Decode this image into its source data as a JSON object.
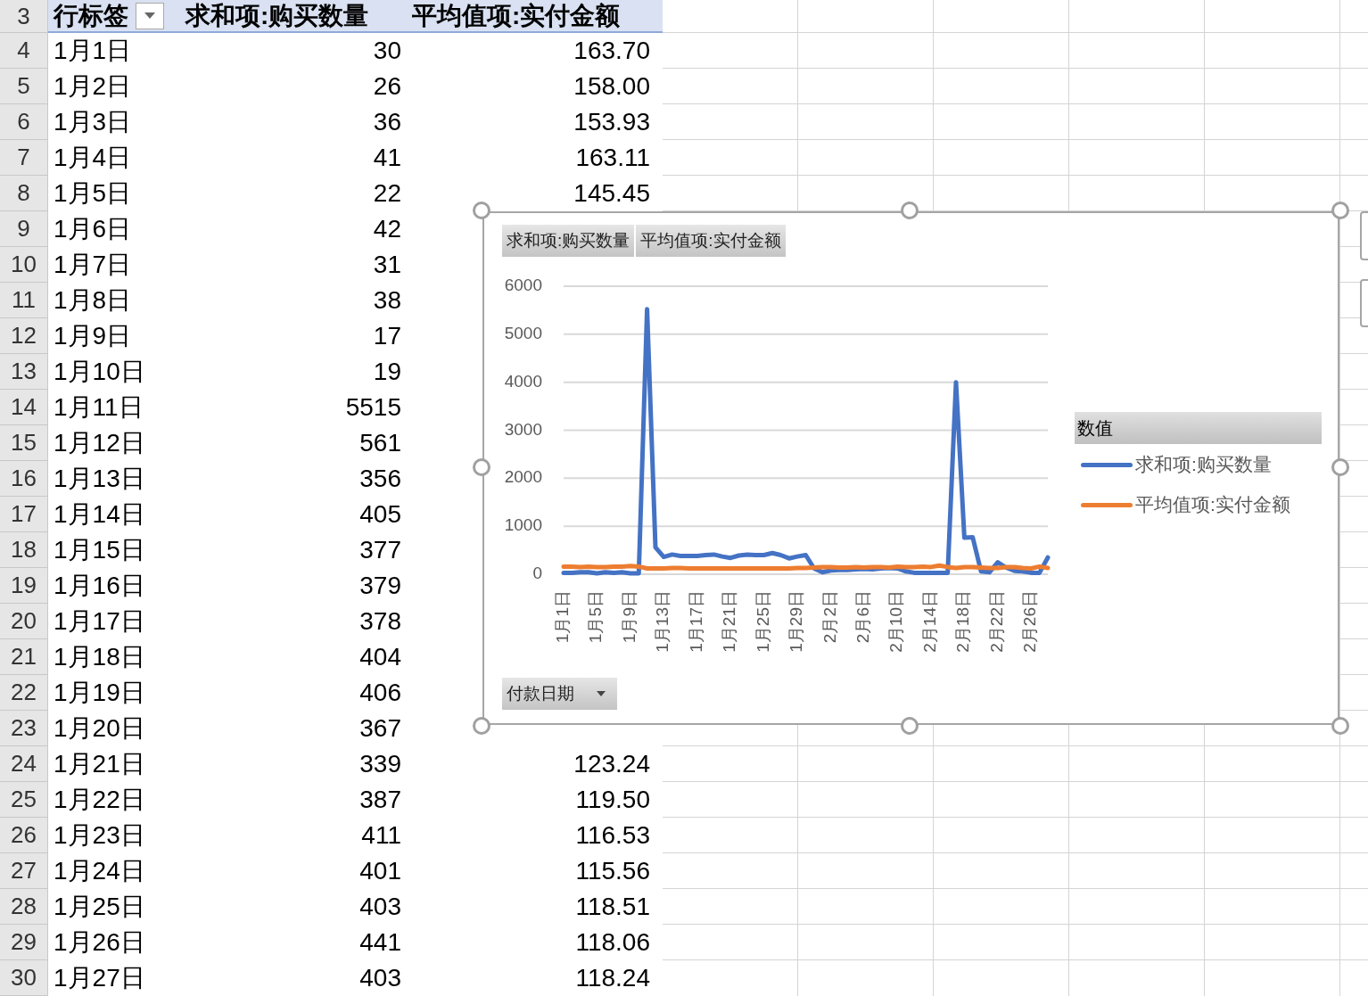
{
  "header": {
    "row_number": "3",
    "row_label": "行标签",
    "col_c": "求和项:购买数量",
    "col_d": "平均值项:实付金额"
  },
  "rows": [
    {
      "number": "4",
      "label": "1月1日",
      "quantity": "30",
      "amount": "163.70"
    },
    {
      "number": "5",
      "label": "1月2日",
      "quantity": "26",
      "amount": "158.00"
    },
    {
      "number": "6",
      "label": "1月3日",
      "quantity": "36",
      "amount": "153.93"
    },
    {
      "number": "7",
      "label": "1月4日",
      "quantity": "41",
      "amount": "163.11"
    },
    {
      "number": "8",
      "label": "1月5日",
      "quantity": "22",
      "amount": "145.45"
    },
    {
      "number": "9",
      "label": "1月6日",
      "quantity": "42"
    },
    {
      "number": "10",
      "label": "1月7日",
      "quantity": "31"
    },
    {
      "number": "11",
      "label": "1月8日",
      "quantity": "38"
    },
    {
      "number": "12",
      "label": "1月9日",
      "quantity": "17"
    },
    {
      "number": "13",
      "label": "1月10日",
      "quantity": "19"
    },
    {
      "number": "14",
      "label": "1月11日",
      "quantity": "5515"
    },
    {
      "number": "15",
      "label": "1月12日",
      "quantity": "561"
    },
    {
      "number": "16",
      "label": "1月13日",
      "quantity": "356"
    },
    {
      "number": "17",
      "label": "1月14日",
      "quantity": "405"
    },
    {
      "number": "18",
      "label": "1月15日",
      "quantity": "377"
    },
    {
      "number": "19",
      "label": "1月16日",
      "quantity": "379"
    },
    {
      "number": "20",
      "label": "1月17日",
      "quantity": "378"
    },
    {
      "number": "21",
      "label": "1月18日",
      "quantity": "404"
    },
    {
      "number": "22",
      "label": "1月19日",
      "quantity": "406"
    },
    {
      "number": "23",
      "label": "1月20日",
      "quantity": "367"
    },
    {
      "number": "24",
      "label": "1月21日",
      "quantity": "339",
      "amount": "123.24"
    },
    {
      "number": "25",
      "label": "1月22日",
      "quantity": "387",
      "amount": "119.50"
    },
    {
      "number": "26",
      "label": "1月23日",
      "quantity": "411",
      "amount": "116.53"
    },
    {
      "number": "27",
      "label": "1月24日",
      "quantity": "401",
      "amount": "115.56"
    },
    {
      "number": "28",
      "label": "1月25日",
      "quantity": "403",
      "amount": "118.51"
    },
    {
      "number": "29",
      "label": "1月26日",
      "quantity": "441",
      "amount": "118.06"
    },
    {
      "number": "30",
      "label": "1月27日",
      "quantity": "403",
      "amount": "118.24"
    }
  ],
  "chart": {
    "value_buttons": [
      "求和项:购买数量",
      "平均值项:实付金额"
    ],
    "axis_button": "付款日期",
    "legend_title": "数值",
    "chart_data": {
      "type": "line",
      "categories": [
        "1月1日",
        null,
        null,
        null,
        "1月5日",
        null,
        null,
        null,
        "1月9日",
        null,
        null,
        null,
        "1月13日",
        null,
        null,
        null,
        "1月17日",
        null,
        null,
        null,
        "1月21日",
        null,
        null,
        null,
        "1月25日",
        null,
        null,
        null,
        "1月29日",
        null,
        null,
        null,
        "2月2日",
        null,
        null,
        null,
        "2月6日",
        null,
        null,
        null,
        "2月10日",
        null,
        null,
        null,
        "2月14日",
        null,
        null,
        null,
        "2月18日",
        null,
        null,
        null,
        "2月22日",
        null,
        null,
        null,
        "2月26日",
        null,
        null
      ],
      "series": [
        {
          "name": "求和项:购买数量",
          "color": "#4472c4",
          "values": [
            30,
            30,
            40,
            40,
            20,
            40,
            30,
            40,
            20,
            20,
            5520,
            560,
            360,
            410,
            380,
            380,
            380,
            400,
            410,
            370,
            340,
            390,
            410,
            400,
            400,
            440,
            400,
            330,
            370,
            400,
            120,
            40,
            80,
            90,
            90,
            100,
            110,
            100,
            120,
            130,
            120,
            60,
            30,
            30,
            30,
            30,
            30,
            4000,
            760,
            770,
            60,
            40,
            250,
            140,
            70,
            60,
            30,
            30,
            350
          ]
        },
        {
          "name": "平均值项:实付金额",
          "color": "#ed7d31",
          "values": [
            160,
            160,
            150,
            160,
            150,
            150,
            160,
            160,
            170,
            160,
            120,
            120,
            120,
            130,
            130,
            120,
            120,
            120,
            120,
            120,
            120,
            120,
            120,
            120,
            120,
            120,
            120,
            120,
            130,
            130,
            140,
            150,
            150,
            140,
            140,
            150,
            140,
            150,
            150,
            140,
            160,
            150,
            150,
            160,
            150,
            180,
            150,
            130,
            150,
            150,
            140,
            130,
            130,
            150,
            150,
            130,
            120,
            160,
            130
          ]
        }
      ],
      "grid": true,
      "ylim": [
        0,
        6000
      ],
      "yticks": [
        0,
        1000,
        2000,
        3000,
        4000,
        5000,
        6000
      ]
    }
  }
}
